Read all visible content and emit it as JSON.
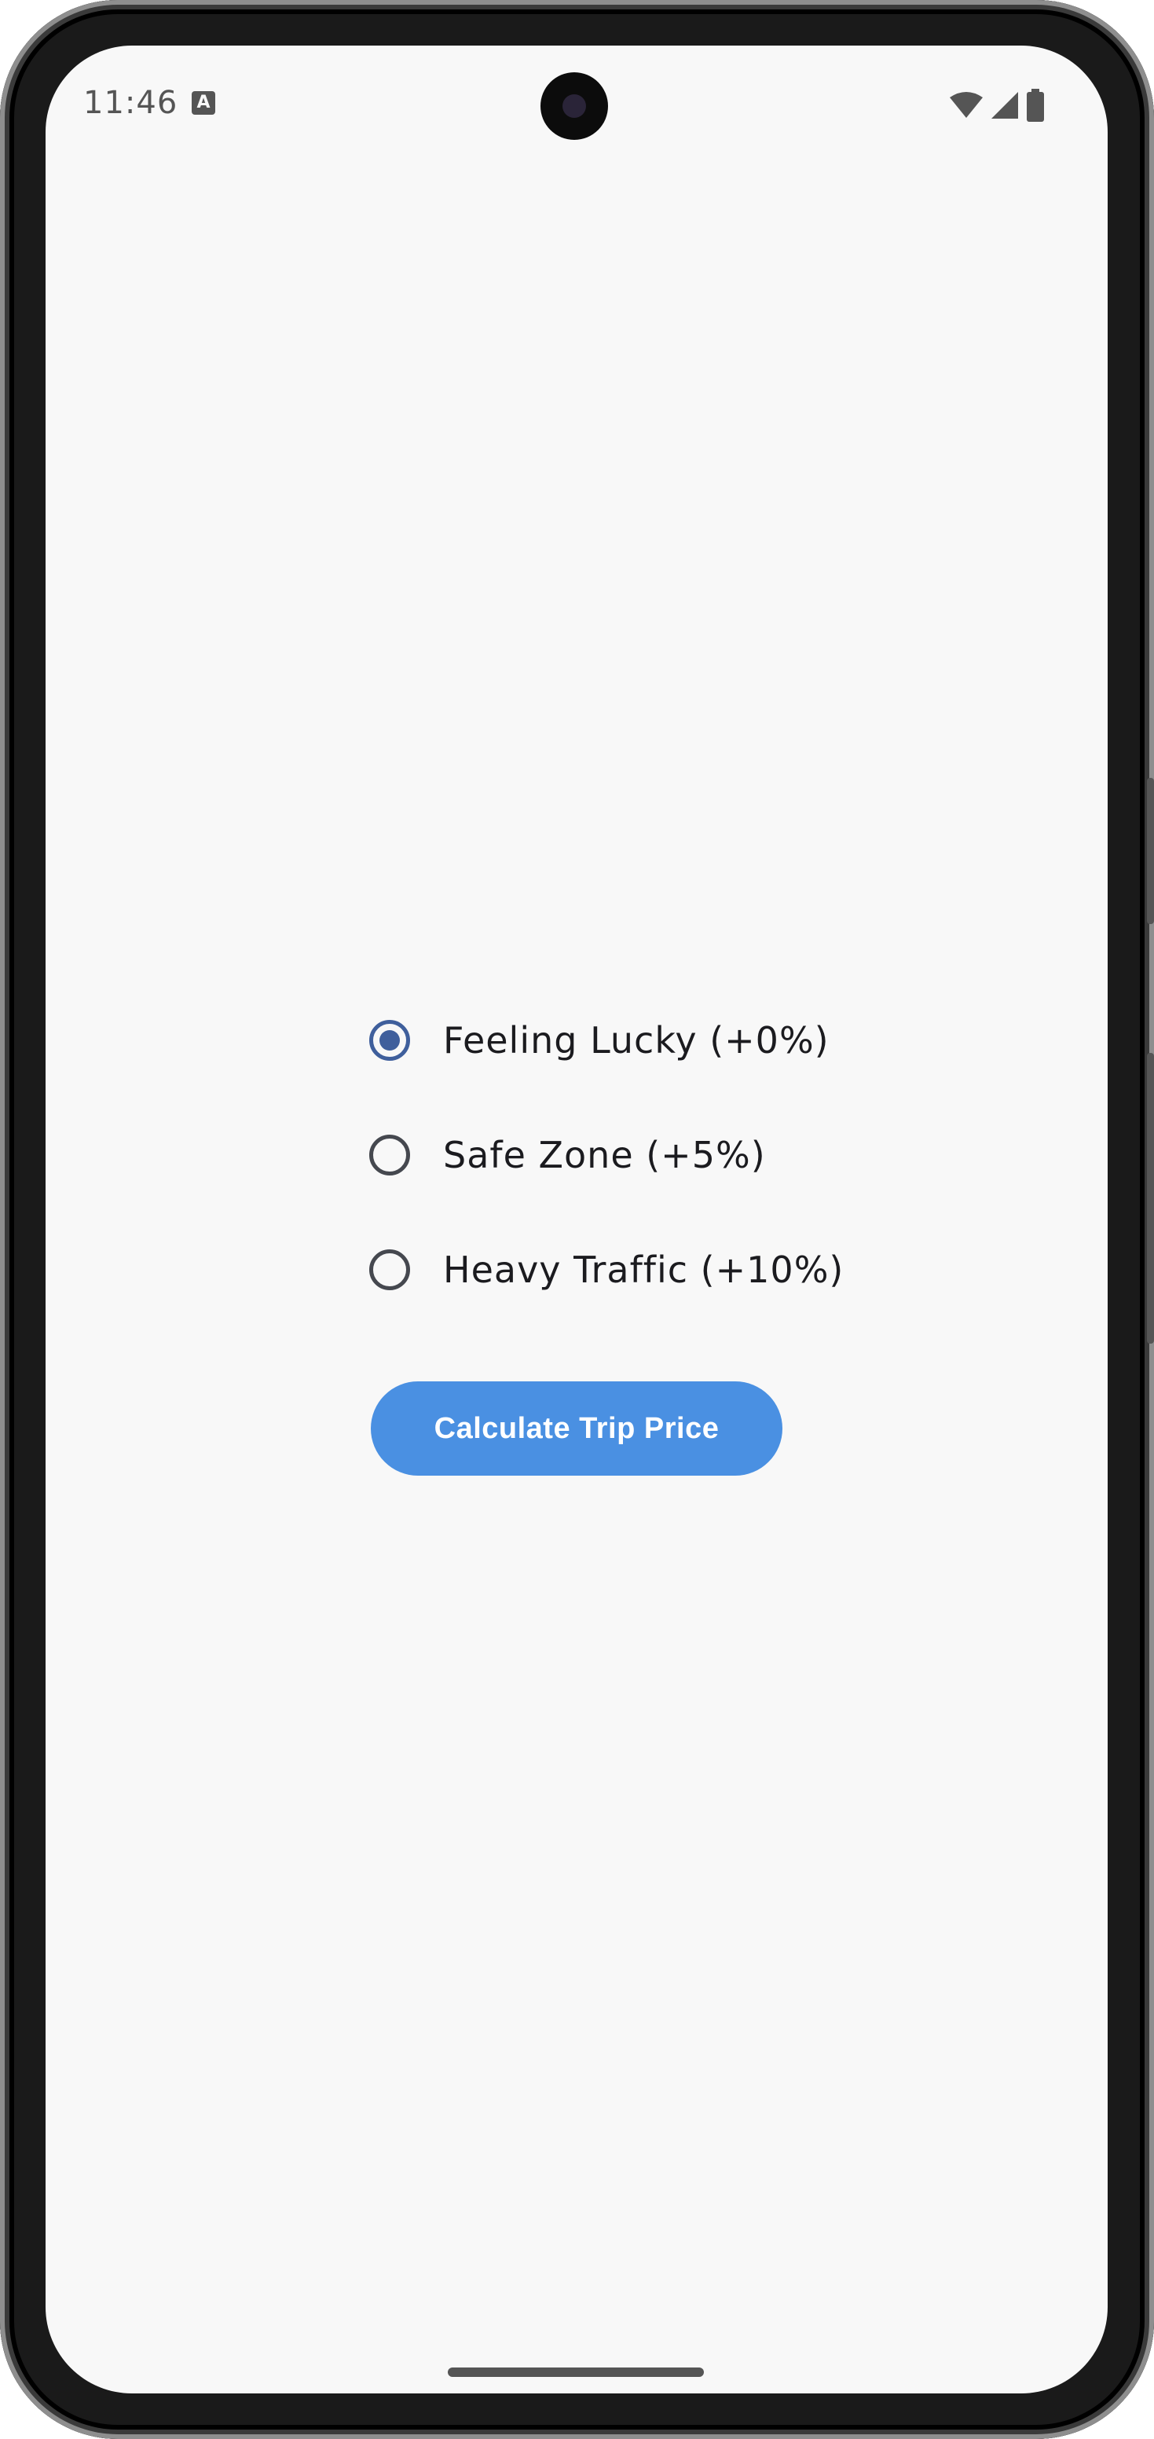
{
  "status_bar": {
    "time": "11:46",
    "icons": [
      "keyboard-a-icon",
      "wifi-icon",
      "cellular-signal-icon",
      "battery-icon"
    ],
    "icon_color": "#555555"
  },
  "options": [
    {
      "label": "Feeling Lucky (+0%)",
      "checked": true
    },
    {
      "label": "Safe Zone (+5%)",
      "checked": false
    },
    {
      "label": "Heavy Traffic (+10%)",
      "checked": false
    }
  ],
  "calculate_button": {
    "label": "Calculate Trip Price"
  },
  "colors": {
    "accent": "#3f5f9c",
    "button": "#4a90e2",
    "background": "#f8f8f8"
  }
}
